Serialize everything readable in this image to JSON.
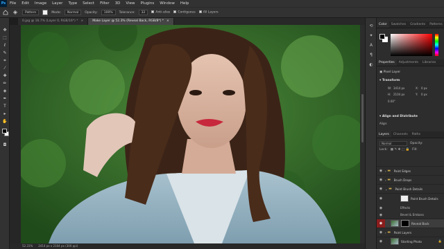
{
  "app": {
    "logo": "Ps"
  },
  "menu": [
    "File",
    "Edit",
    "Image",
    "Layer",
    "Type",
    "Select",
    "Filter",
    "3D",
    "View",
    "Plugins",
    "Window",
    "Help"
  ],
  "options_bar": {
    "source": "Pattern",
    "mode_label": "Mode:",
    "mode_value": "Normal",
    "opacity_label": "Opacity:",
    "opacity_value": "100%",
    "tolerance_label": "Tolerance:",
    "tolerance_value": "32",
    "anti_alias": "Anti-alias",
    "contiguous": "Contiguous",
    "all_layers": "All Layers"
  },
  "tabs": [
    {
      "label": "0.jpg @ 16.7% (Layer 0, RGB/16*) *",
      "active": false
    },
    {
      "label": "Make Layer @ 52.3% (Reveal Back, RGB/8*) *",
      "active": true
    }
  ],
  "status": {
    "zoom": "52.31%",
    "doc": "2414 px x 2104 px (300 ppi)"
  },
  "color_panel": {
    "tabs": [
      "Color",
      "Swatches",
      "Gradients",
      "Patterns"
    ]
  },
  "properties": {
    "tabs": [
      "Properties",
      "Adjustments",
      "Libraries"
    ],
    "layer_type": "Pixel Layer",
    "transform_title": "Transform",
    "w_label": "W:",
    "w_value": "3414 px",
    "h_label": "H:",
    "h_value": "2104 px",
    "x_label": "X:",
    "x_value": "0 px",
    "y_label": "Y:",
    "y_value": "0 px",
    "angle": "0.00°",
    "align_title": "Align and Distribute",
    "align_label": "Align:"
  },
  "layers_panel": {
    "tabs": [
      "Layers",
      "Channels",
      "Paths"
    ],
    "blend_mode": "Normal",
    "opacity_label": "Opacity:",
    "lock_label": "Lock:",
    "fill_label": "Fill:",
    "layers": [
      {
        "name": "Paint Edges",
        "kind": "folder"
      },
      {
        "name": "Brush Drops",
        "kind": "folder"
      },
      {
        "name": "Paint Brush Details",
        "kind": "folder"
      },
      {
        "name": "Paint Brush Details",
        "kind": "layer-fx"
      },
      {
        "name": "Effects",
        "kind": "effects"
      },
      {
        "name": "Bevel & Emboss",
        "kind": "effect"
      },
      {
        "name": "Reveal Back",
        "kind": "masked",
        "selected": true
      },
      {
        "name": "Paint Layers",
        "kind": "folder"
      },
      {
        "name": "Starting Photo",
        "kind": "photo"
      }
    ]
  },
  "colors": {
    "accent_red": "#8a1d1d",
    "panel_bg": "#2d2d2d",
    "ui_bg": "#323232"
  }
}
